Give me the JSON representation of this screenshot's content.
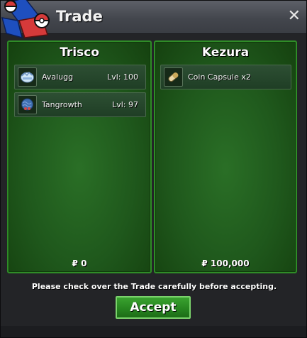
{
  "window": {
    "title": "Trade",
    "close_icon": "close-icon",
    "logo_icon": "pokeball-logo-icon"
  },
  "panels": {
    "left": {
      "player": "Trisco",
      "items": [
        {
          "name": "Avalugg",
          "level": "Lvl: 100",
          "icon": "avalugg-sprite-icon"
        },
        {
          "name": "Tangrowth",
          "level": "Lvl: 97",
          "icon": "tangrowth-sprite-icon"
        }
      ],
      "money": "₽ 0"
    },
    "right": {
      "player": "Kezura",
      "items": [
        {
          "name": "Coin Capsule  x2",
          "icon": "coin-capsule-icon"
        }
      ],
      "money": "₽ 100,000"
    }
  },
  "notice": "Please check over the Trade carefully before accepting.",
  "accept_label": "Accept",
  "colors": {
    "panel_green": "#1f581c",
    "panel_border": "#2f8c27",
    "button_green": "#26831f",
    "window_bg": "#232427"
  }
}
